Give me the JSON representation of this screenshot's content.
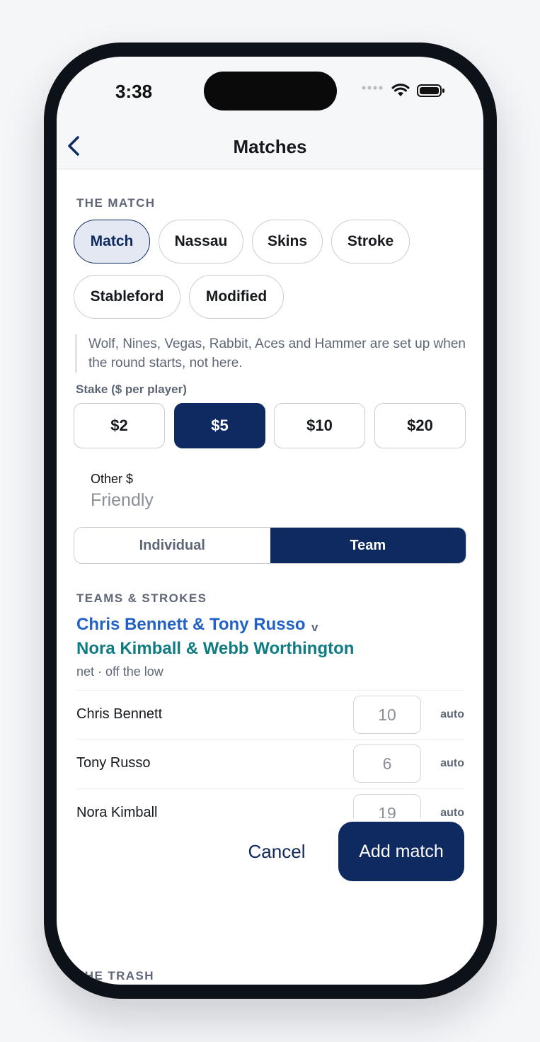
{
  "status": {
    "time": "3:38"
  },
  "nav": {
    "title": "Matches"
  },
  "the_match": {
    "heading": "THE MATCH",
    "formats": [
      "Match",
      "Nassau",
      "Skins",
      "Stroke",
      "Stableford",
      "Modified"
    ],
    "selected_format": "Match",
    "note": "Wolf, Nines, Vegas, Rabbit, Aces and Hammer are set up when the round starts, not here."
  },
  "stake": {
    "label": "Stake ($ per player)",
    "options": [
      "$2",
      "$5",
      "$10",
      "$20"
    ],
    "selected": "$5",
    "other_label": "Other $",
    "other_placeholder": "Friendly"
  },
  "mode": {
    "options": [
      "Individual",
      "Team"
    ],
    "selected": "Team"
  },
  "teams": {
    "heading": "TEAMS & STROKES",
    "team_a": "Chris Bennett & Tony Russo",
    "vs": "v",
    "team_b": "Nora Kimball & Webb Worthington",
    "scoring": "net · off the low",
    "players": [
      {
        "name": "Chris Bennett",
        "strokes": "10",
        "tag": "auto"
      },
      {
        "name": "Tony Russo",
        "strokes": "6",
        "tag": "auto"
      },
      {
        "name": "Nora Kimball",
        "strokes": "19",
        "tag": "auto"
      }
    ]
  },
  "actions": {
    "cancel": "Cancel",
    "add": "Add match"
  },
  "trash": {
    "heading": "THE TRASH"
  },
  "colors": {
    "navy": "#0f2a61",
    "team_a": "#2262c6",
    "team_b": "#0f7c83"
  }
}
